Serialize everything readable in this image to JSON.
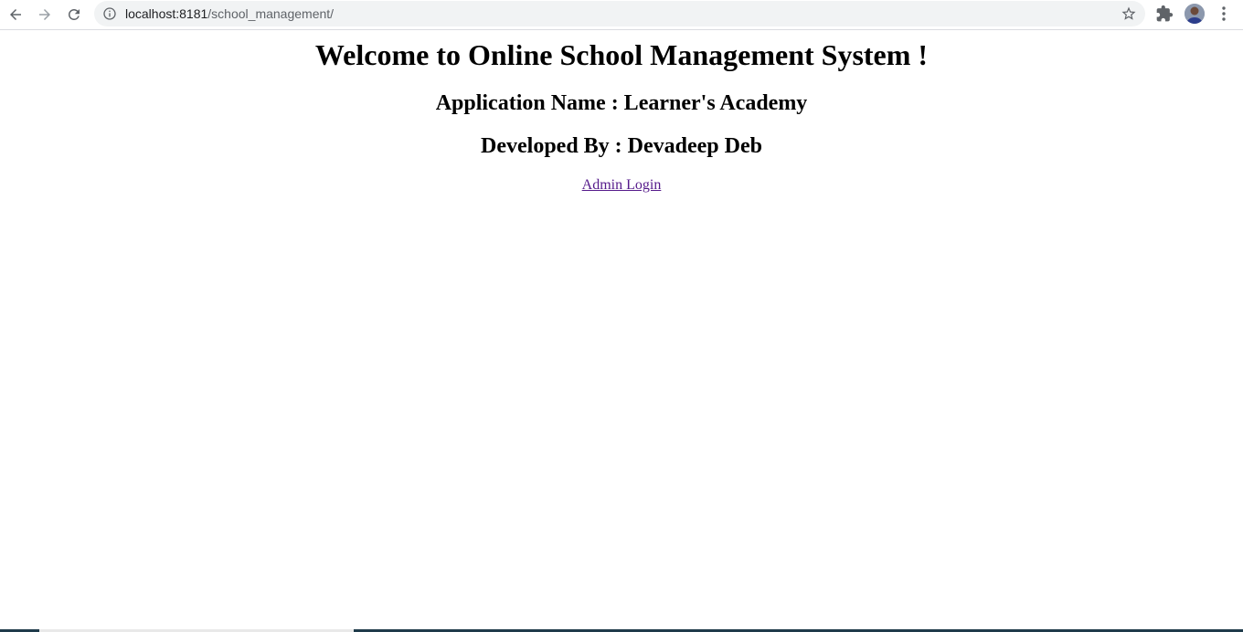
{
  "browser": {
    "url_host": "localhost:8181",
    "url_path": "/school_management/"
  },
  "page": {
    "heading": "Welcome to Online School Management System !",
    "app_name": "Application Name : Learner's Academy",
    "developer": "Developed By : Devadeep Deb",
    "admin_link": "Admin Login"
  },
  "icons": [
    "back-arrow-icon",
    "forward-arrow-icon",
    "reload-icon",
    "info-icon",
    "star-icon",
    "extensions-puzzle-icon",
    "profile-avatar",
    "more-vert-icon"
  ]
}
